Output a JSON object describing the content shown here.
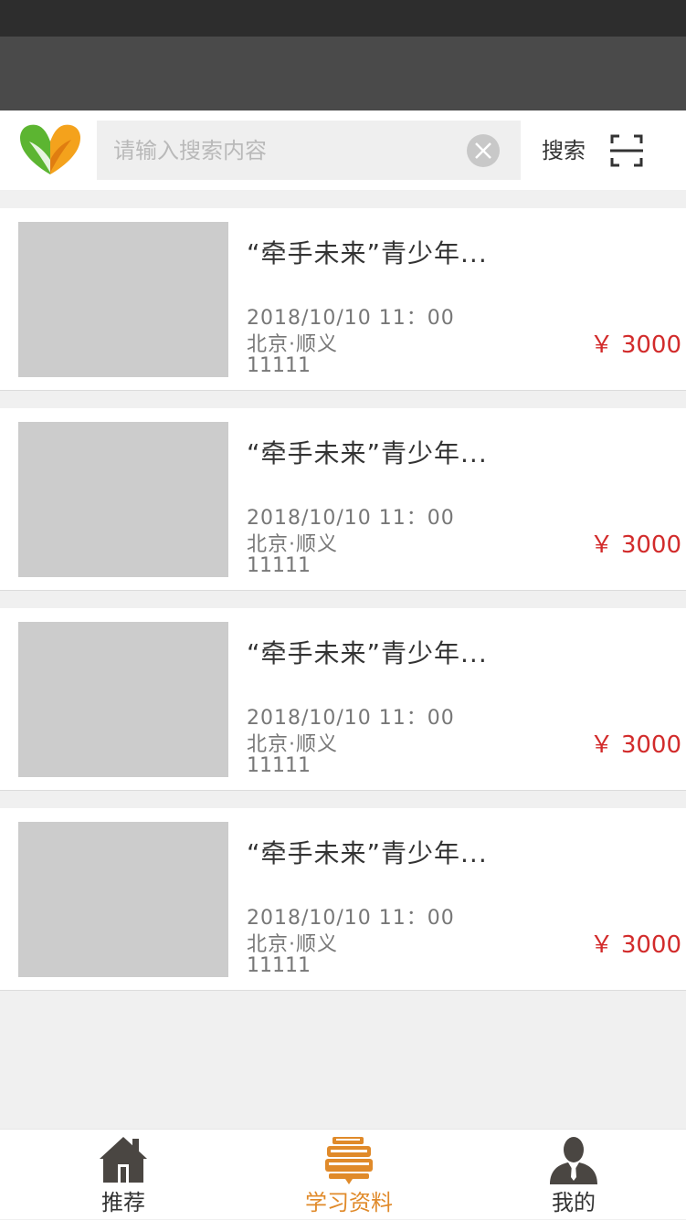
{
  "search": {
    "placeholder": "请输入搜索内容",
    "button_label": "搜索"
  },
  "items": [
    {
      "title": "“牵手未来”青少年...",
      "time": "2018/10/10 11：00",
      "location": "北京·顺义",
      "code": "11111",
      "price": "￥ 3000"
    },
    {
      "title": "“牵手未来”青少年...",
      "time": "2018/10/10 11：00",
      "location": "北京·顺义",
      "code": "11111",
      "price": "￥ 3000"
    },
    {
      "title": "“牵手未来”青少年...",
      "time": "2018/10/10 11：00",
      "location": "北京·顺义",
      "code": "11111",
      "price": "￥ 3000"
    },
    {
      "title": "“牵手未来”青少年...",
      "time": "2018/10/10 11：00",
      "location": "北京·顺义",
      "code": "11111",
      "price": "￥ 3000"
    }
  ],
  "tabs": [
    {
      "label": "推荐",
      "icon": "home-icon",
      "active": false
    },
    {
      "label": "学习资料",
      "icon": "books-icon",
      "active": true
    },
    {
      "label": "我的",
      "icon": "user-icon",
      "active": false
    }
  ],
  "colors": {
    "accent": "#e08a2a",
    "price": "#d22b2b",
    "header_dark": "#2d2d2d",
    "header": "#4a4a4a"
  }
}
